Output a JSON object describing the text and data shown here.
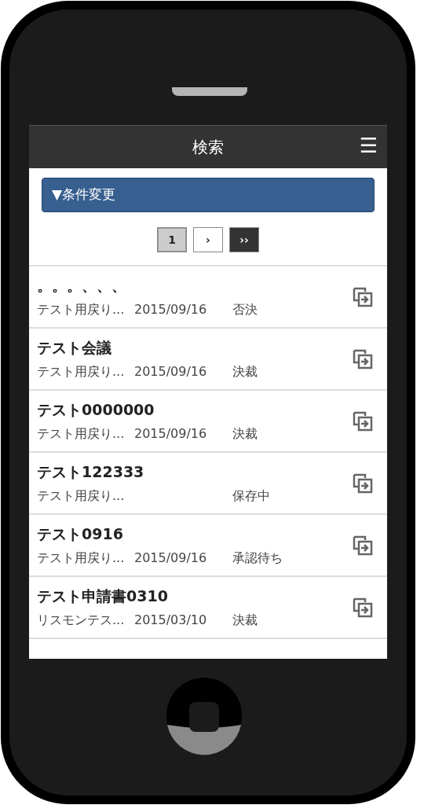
{
  "header": {
    "title": "検索",
    "menu": "☰"
  },
  "filter_button": {
    "label": "▼条件変更"
  },
  "pagination": [
    {
      "kind": "page",
      "label": "1",
      "selected": true
    },
    {
      "kind": "next",
      "label": "›",
      "selected": false
    },
    {
      "kind": "last",
      "label": "››",
      "selected": false
    }
  ],
  "results": [
    {
      "title": "。。。、、、",
      "applicant": "テスト用戻り...",
      "date": "2015/09/16",
      "status": "否決"
    },
    {
      "title": "テスト会議",
      "applicant": "テスト用戻り...",
      "date": "2015/09/16",
      "status": "決裁"
    },
    {
      "title": "テスト0000000",
      "applicant": "テスト用戻り...",
      "date": "2015/09/16",
      "status": "決裁"
    },
    {
      "title": "テスト122333",
      "applicant": "テスト用戻り...",
      "status": "保存中"
    },
    {
      "title": "テスト0916",
      "applicant": "テスト用戻り...",
      "date": "2015/09/16",
      "status": "承認待ち"
    },
    {
      "title": "テスト申請書0310",
      "applicant": "リスモンテス...",
      "date": "2015/03/10",
      "status": "決裁"
    }
  ]
}
